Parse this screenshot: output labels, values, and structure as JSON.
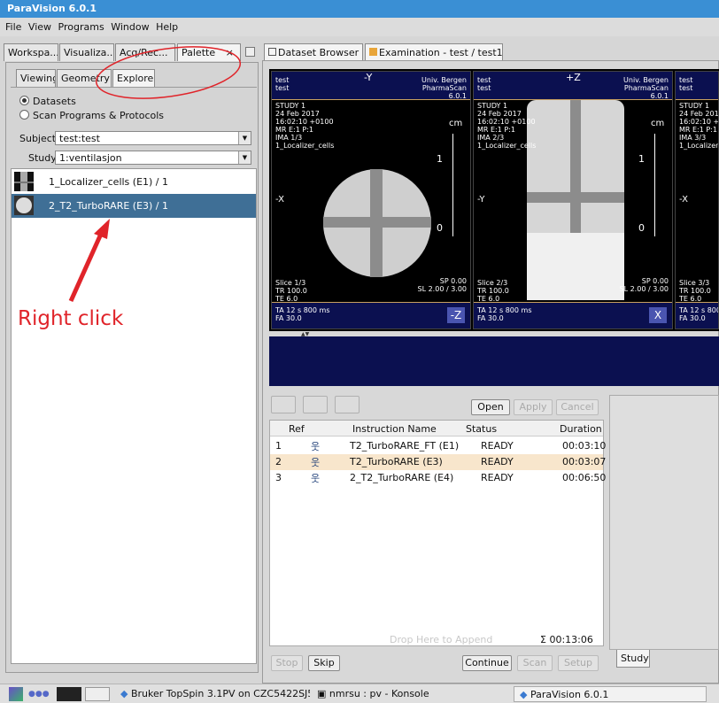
{
  "window": {
    "title": "ParaVision 6.0.1"
  },
  "menu": [
    "File",
    "View",
    "Programs",
    "Window",
    "Help"
  ],
  "left_tabs": [
    "Workspa...",
    "Visualiza...",
    "Acq/Rec...",
    "Palette",
    "×"
  ],
  "sub_tabs": [
    "Viewing",
    "Geometry",
    "Explorer"
  ],
  "radios": {
    "datasets": "Datasets",
    "protocols": "Scan Programs & Protocols"
  },
  "subject": {
    "label": "Subject",
    "value": "test:test"
  },
  "study": {
    "label": "Study",
    "value": "1:ventilasjon"
  },
  "datasets": [
    "1_Localizer_cells (E1) / 1",
    "2_T2_TurboRARE (E3) / 1"
  ],
  "annotation": {
    "text": "Right click",
    "color": "#e0242a"
  },
  "doc_tabs": [
    "Dataset Browser",
    "Examination - test / test15"
  ],
  "viewers": [
    {
      "orient": "-Y",
      "lines": "test\ntest",
      "site": "Univ. Bergen\nPharmaScan\n6.0.1",
      "study": "STUDY 1\n24 Feb 2017\n16:02:10 +0100\nMR E:1 P:1\nIMA 1/3\n1_Localizer_cells",
      "unit": "cm",
      "tick1": "1",
      "tick0": "0",
      "side": "-X",
      "slice": "Slice 1/3\nTR 100.0\nTE 6.0",
      "sp": "SP 0.00\nSL 2.00 / 3.00",
      "ta": "TA 12 s 800 ms\nFA 30.0",
      "bottom": "-Z"
    },
    {
      "orient": "+Z",
      "lines": "test\ntest",
      "site": "Univ. Bergen\nPharmaScan\n6.0.1",
      "study": "STUDY 1\n24 Feb 2017\n16:02:10 +0100\nMR E:1 P:1\nIMA 2/3\n1_Localizer_cells",
      "unit": "cm",
      "tick1": "1",
      "tick0": "0",
      "side": "-Y",
      "slice": "Slice 2/3\nTR 100.0\nTE 6.0",
      "sp": "SP 0.00\nSL 2.00 / 3.00",
      "ta": "TA 12 s 800 ms\nFA 30.0",
      "bottom": "X"
    },
    {
      "orient": "",
      "lines": "test\ntest",
      "site": "",
      "study": "STUDY 1\n24 Feb 2017\n16:02:10 +01\nMR E:1 P:1\nIMA 3/3\n1_Localizer_c",
      "unit": "",
      "tick1": "",
      "tick0": "",
      "side": "-X",
      "slice": "Slice 3/3\nTR 100.0\nTE 6.0",
      "sp": "",
      "ta": "TA 12 s 800 m\nFA 30.0",
      "bottom": ""
    }
  ],
  "action_buttons": {
    "open": "Open",
    "apply": "Apply",
    "cancel": "Cancel"
  },
  "table": {
    "headers": [
      "Ref",
      "Instruction Name",
      "Status",
      "Duration"
    ],
    "rows": [
      {
        "num": "1",
        "name": "T2_TurboRARE_FT (E1)",
        "status": "READY",
        "duration": "00:03:10"
      },
      {
        "num": "2",
        "name": "T2_TurboRARE (E3)",
        "status": "READY",
        "duration": "00:03:07"
      },
      {
        "num": "3",
        "name": "2_T2_TurboRARE (E4)",
        "status": "READY",
        "duration": "00:06:50"
      }
    ],
    "drop_hint": "Drop Here to Append",
    "total": "Σ 00:13:06"
  },
  "bottom_buttons": {
    "stop": "Stop",
    "skip": "Skip",
    "continue": "Continue",
    "scan": "Scan",
    "setup": "Setup"
  },
  "study_tab": "Study",
  "taskbar": {
    "item1": "Bruker TopSpin 3.1PV on CZC5422SJ5 as nm",
    "item2": "nmrsu : pv - Konsole",
    "item3": "ParaVision 6.0.1"
  },
  "colors": {
    "selection": "#3f6f96",
    "titlebar": "#3a8fd4",
    "row_highlight": "#f8e6cc"
  }
}
